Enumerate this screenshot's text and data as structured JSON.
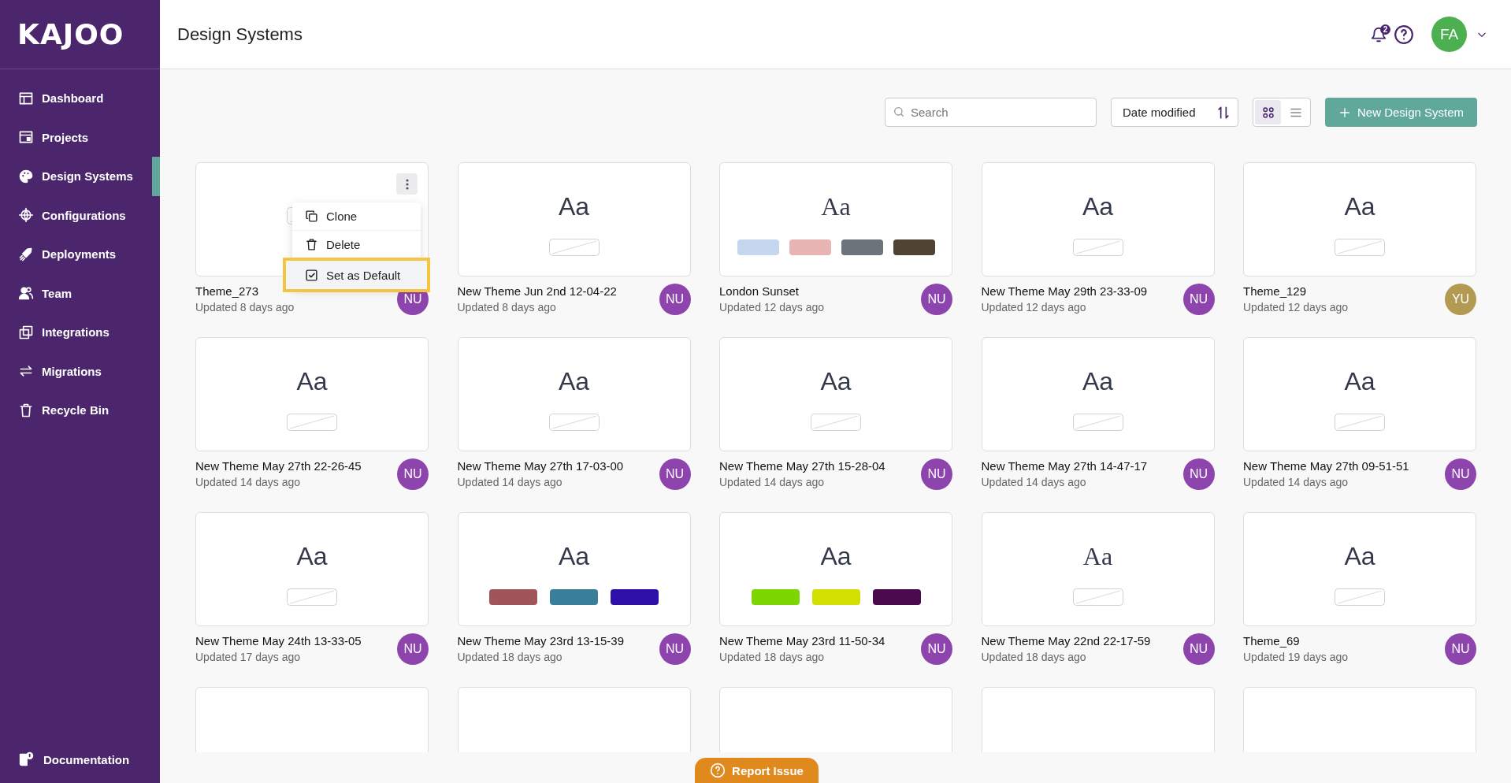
{
  "sidebar": {
    "logo": "KAJOO",
    "items": [
      {
        "label": "Dashboard",
        "selected": false
      },
      {
        "label": "Projects",
        "selected": false
      },
      {
        "label": "Design Systems",
        "selected": true
      },
      {
        "label": "Configurations",
        "selected": false
      },
      {
        "label": "Deployments",
        "selected": false
      },
      {
        "label": "Team",
        "selected": false
      },
      {
        "label": "Integrations",
        "selected": false
      },
      {
        "label": "Migrations",
        "selected": false
      },
      {
        "label": "Recycle Bin",
        "selected": false
      }
    ],
    "footer_item": {
      "label": "Documentation"
    }
  },
  "header": {
    "title": "Design Systems",
    "notification_count": "2",
    "user": {
      "initials": "FA",
      "color": "#4caf50"
    }
  },
  "toolbar": {
    "search": {
      "placeholder": "Search"
    },
    "sort": {
      "label": "Date modified"
    },
    "views": [
      {
        "kind": "grid",
        "selected": true
      },
      {
        "kind": "list",
        "selected": false
      }
    ],
    "new_button": "New Design System"
  },
  "cards": [
    {
      "name": "Theme_273",
      "updated": "Updated 8 days ago",
      "kind": "sans",
      "avatar": {
        "initials": "NU",
        "color": "#8e44ad"
      },
      "menu": [
        {
          "label": "Clone",
          "kind": "clone",
          "selected": false
        },
        {
          "label": "Delete",
          "kind": "delete",
          "selected": false
        },
        {
          "label": "Set as Default",
          "kind": "default",
          "selected": true
        }
      ]
    },
    {
      "name": "New Theme Jun 2nd 12-04-22",
      "updated": "Updated 8 days ago",
      "preview": "Aa",
      "kind": "sans",
      "avatar": {
        "initials": "NU",
        "color": "#8e44ad"
      }
    },
    {
      "name": "London Sunset",
      "updated": "Updated 12 days ago",
      "preview": "Aa",
      "kind": "serif",
      "swatches": [
        {
          "color": "#c5d7ef"
        },
        {
          "color": "#e8b4b4"
        },
        {
          "color": "#6c737a"
        },
        {
          "color": "#4f4434"
        }
      ],
      "avatar": {
        "initials": "NU",
        "color": "#8e44ad"
      }
    },
    {
      "name": "New Theme May 29th 23-33-09",
      "updated": "Updated 12 days ago",
      "preview": "Aa",
      "kind": "sans",
      "avatar": {
        "initials": "NU",
        "color": "#8e44ad"
      }
    },
    {
      "name": "Theme_129",
      "updated": "Updated 12 days ago",
      "preview": "Aa",
      "kind": "sans",
      "avatar": {
        "initials": "YU",
        "color": "#b39a52"
      }
    },
    {
      "name": "New Theme May 27th 22-26-45",
      "updated": "Updated 14 days ago",
      "preview": "Aa",
      "kind": "sans",
      "avatar": {
        "initials": "NU",
        "color": "#8e44ad"
      }
    },
    {
      "name": "New Theme May 27th 17-03-00",
      "updated": "Updated 14 days ago",
      "preview": "Aa",
      "kind": "sans",
      "avatar": {
        "initials": "NU",
        "color": "#8e44ad"
      }
    },
    {
      "name": "New Theme May 27th 15-28-04",
      "updated": "Updated 14 days ago",
      "preview": "Aa",
      "kind": "sans",
      "avatar": {
        "initials": "NU",
        "color": "#8e44ad"
      }
    },
    {
      "name": "New Theme May 27th 14-47-17",
      "updated": "Updated 14 days ago",
      "preview": "Aa",
      "kind": "sans",
      "avatar": {
        "initials": "NU",
        "color": "#8e44ad"
      }
    },
    {
      "name": "New Theme May 27th 09-51-51",
      "updated": "Updated 14 days ago",
      "preview": "Aa",
      "kind": "sans",
      "avatar": {
        "initials": "NU",
        "color": "#8e44ad"
      }
    },
    {
      "name": "New Theme May 24th 13-33-05",
      "updated": "Updated 17 days ago",
      "preview": "Aa",
      "kind": "sans",
      "avatar": {
        "initials": "NU",
        "color": "#8e44ad"
      }
    },
    {
      "name": "New Theme May 23rd 13-15-39",
      "updated": "Updated 18 days ago",
      "preview": "Aa",
      "kind": "sans",
      "swatches": [
        {
          "color": "#a0555a"
        },
        {
          "color": "#3a7f99"
        },
        {
          "color": "#2e0fa8"
        }
      ],
      "avatar": {
        "initials": "NU",
        "color": "#8e44ad"
      }
    },
    {
      "name": "New Theme May 23rd 11-50-34",
      "updated": "Updated 18 days ago",
      "preview": "Aa",
      "kind": "sans",
      "swatches": [
        {
          "color": "#7ed600"
        },
        {
          "color": "#d4e000"
        },
        {
          "color": "#4a0a4c"
        }
      ],
      "avatar": {
        "initials": "NU",
        "color": "#8e44ad"
      }
    },
    {
      "name": "New Theme May 22nd 22-17-59",
      "updated": "Updated 18 days ago",
      "preview": "Aa",
      "kind": "serif",
      "avatar": {
        "initials": "NU",
        "color": "#8e44ad"
      }
    },
    {
      "name": "Theme_69",
      "updated": "Updated 19 days ago",
      "preview": "Aa",
      "kind": "sans",
      "avatar": {
        "initials": "NU",
        "color": "#8e44ad"
      }
    },
    {
      "kind": "clipped"
    },
    {
      "kind": "clipped"
    },
    {
      "kind": "clipped"
    },
    {
      "kind": "clipped"
    },
    {
      "kind": "clipped"
    }
  ],
  "report_button": "Report Issue"
}
